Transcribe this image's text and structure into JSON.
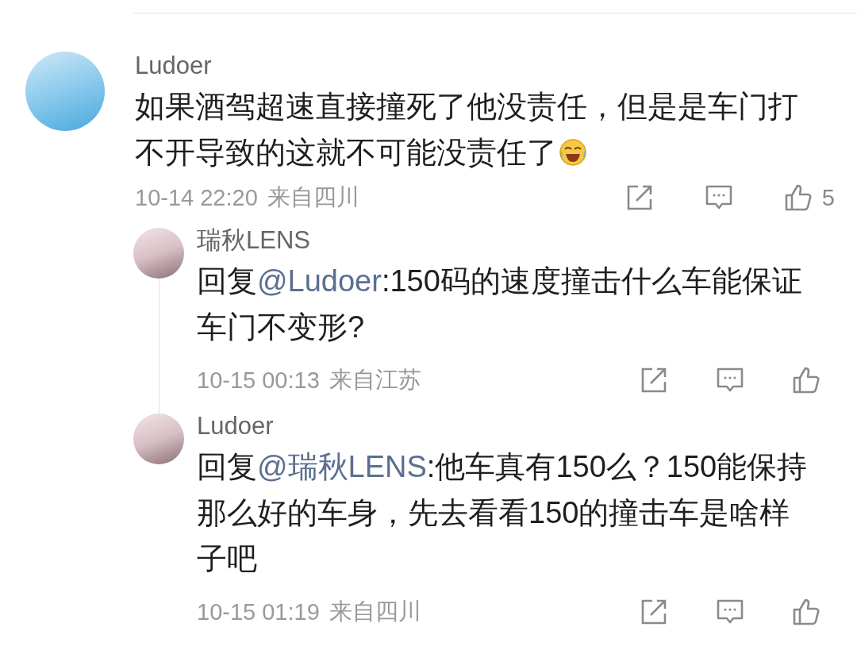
{
  "comments": [
    {
      "author": "Ludoer",
      "body": {
        "text": "如果酒驾超速直接撞死了他没责任，但是是车门打不开导致的这就不可能没责任了",
        "laughing_emoji": true
      },
      "time": "10-14 22:20",
      "location": "来自四川",
      "likes": "5",
      "replies": [
        {
          "author": "瑞秋LENS",
          "body": {
            "prefix": "回复",
            "mention": "@Ludoer",
            "text": ":150码的速度撞击什么车能保证车门不变形?"
          },
          "time": "10-15 00:13",
          "location": "来自江苏"
        },
        {
          "author": "Ludoer",
          "body": {
            "prefix": "回复",
            "mention": "@瑞秋LENS",
            "text": ":他车真有150么？150能保持那么好的车身，先去看看150的撞击车是啥样子吧"
          },
          "time": "10-15 01:19",
          "location": "来自四川"
        }
      ]
    }
  ]
}
